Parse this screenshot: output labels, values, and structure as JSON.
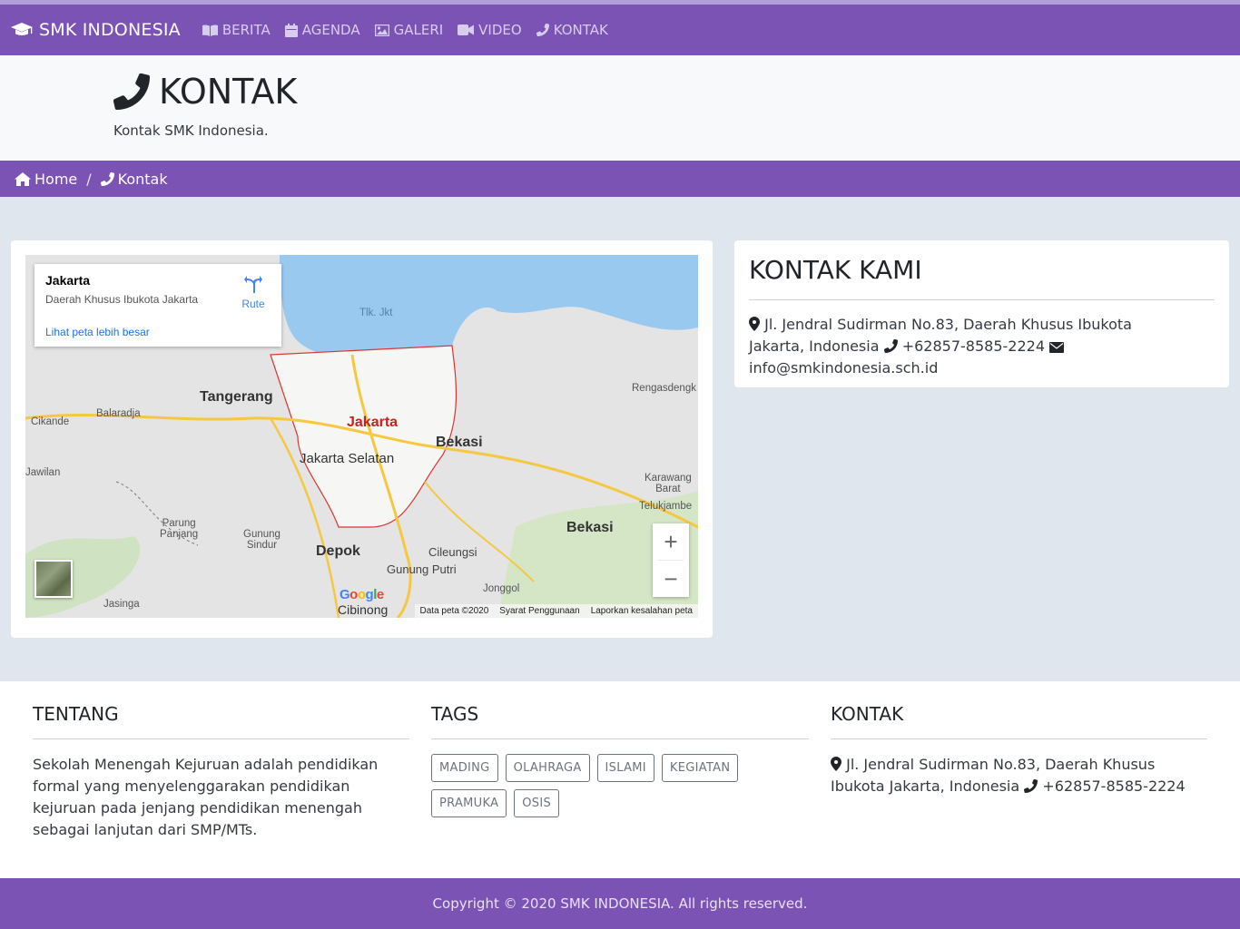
{
  "nav": {
    "brand": "SMK INDONESIA",
    "items": [
      {
        "label": "BERITA",
        "icon": "book-open-icon"
      },
      {
        "label": "AGENDA",
        "icon": "calendar-icon"
      },
      {
        "label": "GALERI",
        "icon": "image-icon"
      },
      {
        "label": "VIDEO",
        "icon": "video-icon"
      },
      {
        "label": "KONTAK",
        "icon": "phone-icon"
      }
    ]
  },
  "header": {
    "title": "KONTAK",
    "subtitle": "Kontak SMK Indonesia."
  },
  "breadcrumb": {
    "home": "Home",
    "separator": "/",
    "current": "Kontak"
  },
  "map": {
    "info_title": "Jakarta",
    "info_subtitle": "Daerah Khusus Ibukota Jakarta",
    "info_link": "Lihat peta lebih besar",
    "directions_label": "Rute",
    "labels": {
      "tlk": "Tlk. Jkt",
      "rengasdengk": "Rengasdengk",
      "tangerang": "Tangerang",
      "balaradja": "Balaradja",
      "cikande": "Cikande",
      "jakarta": "Jakarta",
      "bekasi1": "Bekasi",
      "jakarta_selatan": "Jakarta Selatan",
      "jawilan": "Jawilan",
      "karawang": "Karawang\nBarat",
      "telukjambe": "Telukjambe",
      "parung": "Parung\nPanjang",
      "gunung_sindur": "Gunung\nSindur",
      "bekasi2": "Bekasi",
      "depok": "Depok",
      "cileungsi": "Cileungsi",
      "gunung_putri": "Gunung Putri",
      "jonggol": "Jonggol",
      "jasinga": "Jasinga",
      "cibinong": "Cibinong"
    },
    "zoom_in": "+",
    "zoom_out": "−",
    "google": "Google",
    "attribution": [
      "Data peta ©2020",
      "Syarat Penggunaan",
      "Laporkan kesalahan peta"
    ]
  },
  "contact_card": {
    "title": "KONTAK KAMI",
    "address": "Jl. Jendral Sudirman No.83, Daerah Khusus Ibukota Jakarta, Indonesia",
    "phone": "+62857-8585-2224",
    "email": "info@smkindonesia.sch.id"
  },
  "footer": {
    "about_title": "TENTANG",
    "about_text": "Sekolah Menengah Kejuruan adalah pendidikan formal yang menyelenggarakan pendidikan kejuruan pada jenjang pendidikan menengah sebagai lanjutan dari SMP/MTs.",
    "tags_title": "TAGS",
    "tags": [
      "MADING",
      "OLAHRAGA",
      "ISLAMI",
      "KEGIATAN",
      "PRAMUKA",
      "OSIS"
    ],
    "contact_title": "KONTAK",
    "contact_address": "Jl. Jendral Sudirman No.83, Daerah Khusus Ibukota Jakarta, Indonesia",
    "contact_phone": "+62857-8585-2224",
    "copyright": "Copyright © 2020 SMK INDONESIA. All rights reserved."
  },
  "colors": {
    "primary": "#7b53b5",
    "topline": "#b39ddb",
    "background": "#e0e6ee"
  }
}
